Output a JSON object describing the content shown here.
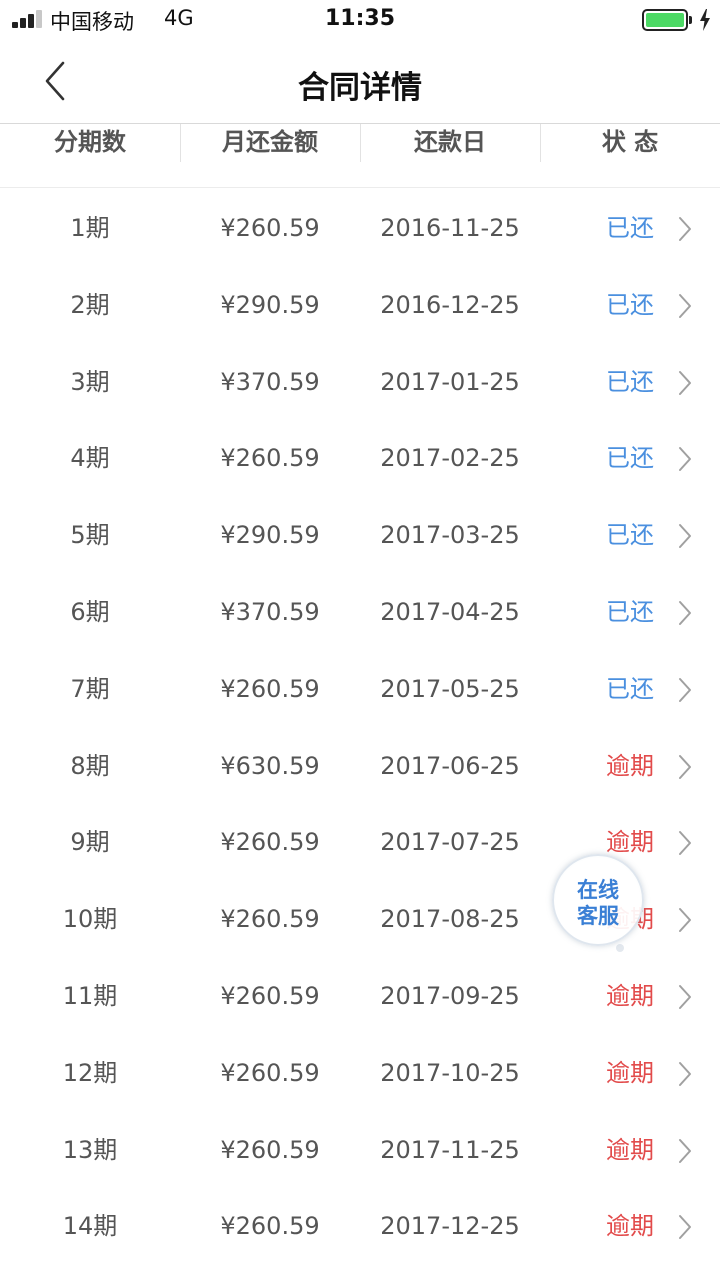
{
  "status_bar": {
    "carrier": "中国移动",
    "network": "4G",
    "time": "11:35",
    "battery_level": 1.0
  },
  "nav": {
    "title": "合同详情",
    "back_icon": "chevron-left-icon"
  },
  "table": {
    "headers": [
      "分期数",
      "月还金额",
      "还款日",
      "状 态"
    ],
    "rows": [
      {
        "term": "1期",
        "amount": "¥260.59",
        "date": "2016-11-25",
        "status": "已还",
        "status_type": "paid"
      },
      {
        "term": "2期",
        "amount": "¥290.59",
        "date": "2016-12-25",
        "status": "已还",
        "status_type": "paid"
      },
      {
        "term": "3期",
        "amount": "¥370.59",
        "date": "2017-01-25",
        "status": "已还",
        "status_type": "paid"
      },
      {
        "term": "4期",
        "amount": "¥260.59",
        "date": "2017-02-25",
        "status": "已还",
        "status_type": "paid"
      },
      {
        "term": "5期",
        "amount": "¥290.59",
        "date": "2017-03-25",
        "status": "已还",
        "status_type": "paid"
      },
      {
        "term": "6期",
        "amount": "¥370.59",
        "date": "2017-04-25",
        "status": "已还",
        "status_type": "paid"
      },
      {
        "term": "7期",
        "amount": "¥260.59",
        "date": "2017-05-25",
        "status": "已还",
        "status_type": "paid"
      },
      {
        "term": "8期",
        "amount": "¥630.59",
        "date": "2017-06-25",
        "status": "逾期",
        "status_type": "overdue"
      },
      {
        "term": "9期",
        "amount": "¥260.59",
        "date": "2017-07-25",
        "status": "逾期",
        "status_type": "overdue"
      },
      {
        "term": "10期",
        "amount": "¥260.59",
        "date": "2017-08-25",
        "status": "逾期",
        "status_type": "overdue"
      },
      {
        "term": "11期",
        "amount": "¥260.59",
        "date": "2017-09-25",
        "status": "逾期",
        "status_type": "overdue"
      },
      {
        "term": "12期",
        "amount": "¥260.59",
        "date": "2017-10-25",
        "status": "逾期",
        "status_type": "overdue"
      },
      {
        "term": "13期",
        "amount": "¥260.59",
        "date": "2017-11-25",
        "status": "逾期",
        "status_type": "overdue"
      },
      {
        "term": "14期",
        "amount": "¥260.59",
        "date": "2017-12-25",
        "status": "逾期",
        "status_type": "overdue"
      }
    ]
  },
  "customer_service": {
    "line1": "在线",
    "line2": "客服"
  },
  "colors": {
    "paid": "#4a8fdf",
    "overdue": "#e24b4b",
    "battery": "#4cd964"
  }
}
